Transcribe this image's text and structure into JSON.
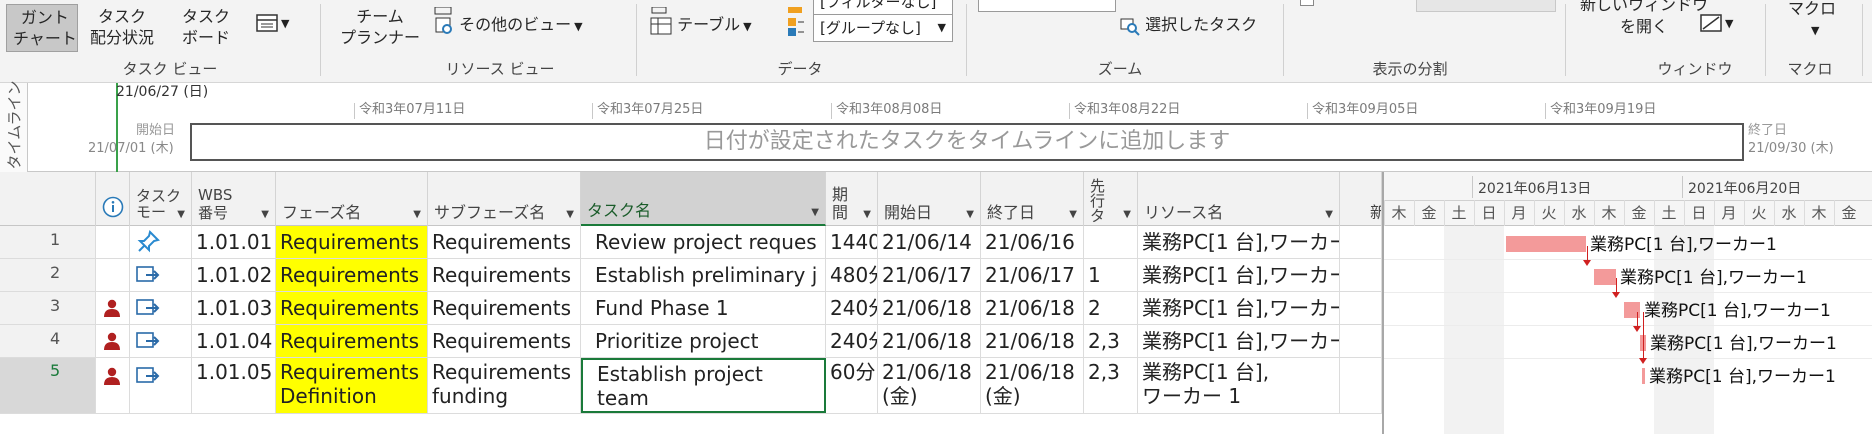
{
  "ribbon": {
    "gantt_chart": "ガント\nチャート",
    "task_usage": "タスク\n配分状況",
    "task_board": "タスク\nボード",
    "team_planner": "チーム\nプランナー",
    "other_views": "その他のビュー",
    "table": "テーブル",
    "filter_value": "[フィルターなし]",
    "group_value": "[グループなし]",
    "selected_tasks": "選択したタスク",
    "new_window": "新しいウィンドウ\nを開く",
    "macro": "マクロ",
    "groups": {
      "task_views": "タスク ビュー",
      "resource_views": "リソース ビュー",
      "data": "データ",
      "zoom": "ズーム",
      "split_view": "表示の分割",
      "window": "ウィンドウ",
      "macro": "マクロ"
    }
  },
  "timeline": {
    "side_label": "タイムライン",
    "today": "21/06/27 (日)",
    "start_label": "開始日",
    "start_date": "21/07/01 (木)",
    "end_label": "終了日",
    "end_date": "21/09/30 (木)",
    "placeholder": "日付が設定されたタスクをタイムラインに追加します",
    "ticks": [
      "令和3年07月11日",
      "令和3年07月25日",
      "令和3年08月08日",
      "令和3年08月22日",
      "令和3年09月05日",
      "令和3年09月19日"
    ]
  },
  "columns": {
    "task_mode": "タスク\nモー",
    "wbs": "WBS\n番号",
    "phase": "フェーズ名",
    "subphase": "サブフェーズ名",
    "task_name": "タスク名",
    "duration": "期\n間",
    "start": "開始日",
    "finish": "終了日",
    "predecessors": "先\n行\nタ",
    "resources": "リソース名",
    "extra": "新"
  },
  "rows": [
    {
      "num": "1",
      "wbs": "1.01.01",
      "phase": "Requirements",
      "subphase": "Requirements",
      "task": "Review project reques",
      "duration": "1440",
      "start": "21/06/14",
      "finish": "21/06/16",
      "pred": "",
      "res": "業務PC[1 台],ワーカー"
    },
    {
      "num": "2",
      "wbs": "1.01.02",
      "phase": "Requirements",
      "subphase": "Requirements",
      "task": "Establish preliminary j",
      "duration": "480分",
      "start": "21/06/17",
      "finish": "21/06/17",
      "pred": "1",
      "res": "業務PC[1 台],ワーカー"
    },
    {
      "num": "3",
      "wbs": "1.01.03",
      "phase": "Requirements",
      "subphase": "Requirements",
      "task": "Fund Phase 1",
      "duration": "240分",
      "start": "21/06/18",
      "finish": "21/06/18",
      "pred": "2",
      "res": "業務PC[1 台],ワーカー"
    },
    {
      "num": "4",
      "wbs": "1.01.04",
      "phase": "Requirements",
      "subphase": "Requirements",
      "task": "Prioritize project",
      "duration": "240分",
      "start": "21/06/18",
      "finish": "21/06/18",
      "pred": "2,3",
      "res": "業務PC[1 台],ワーカー"
    },
    {
      "num": "5",
      "wbs": "1.01.05",
      "phase": "Requirements\nDefinition",
      "subphase": "Requirements\nfunding",
      "task": "Establish project\nteam",
      "duration": "60分",
      "start": "21/06/18\n(金)",
      "finish": "21/06/18\n(金)",
      "pred": "2,3",
      "res": "業務PC[1 台],\nワーカー 1"
    }
  ],
  "gantt": {
    "week1": "2021年06月13日",
    "week2": "2021年06月20日",
    "days": [
      "木",
      "金",
      "土",
      "日",
      "月",
      "火",
      "水",
      "木",
      "金",
      "土",
      "日",
      "月",
      "火",
      "水",
      "木",
      "金"
    ],
    "bar_label": "業務PC[1 台],ワーカー1",
    "bar_color": "#f39a9a"
  }
}
